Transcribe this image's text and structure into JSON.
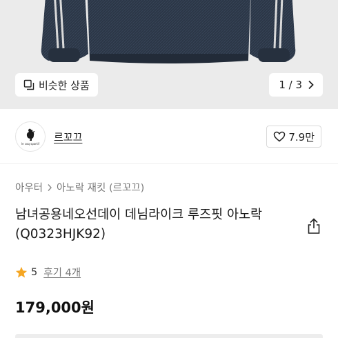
{
  "gallery": {
    "similar_label": "비슷한 상품",
    "page_indicator": "1 / 3",
    "icons": {
      "similar": "copy-icon",
      "next": "chevron-right-icon"
    }
  },
  "shop": {
    "logo_text": "le coq sportif",
    "name": "르꼬끄",
    "likes": "7.9만",
    "icons": {
      "like": "heart-outline-icon",
      "logo": "rooster-logo-icon"
    }
  },
  "breadcrumb": {
    "items": [
      "아우터",
      "아노락 재킷 (르꼬끄)"
    ],
    "separator_icon": "chevron-right-icon"
  },
  "product": {
    "title": "남녀공용네오선데이 데님라이크 루즈핏 아노락 (Q0323HJK92)",
    "rating": "5",
    "reviews": "후기 4개",
    "price": "179,000원",
    "share_icon": "share-icon",
    "star_color": "#f5a623"
  }
}
